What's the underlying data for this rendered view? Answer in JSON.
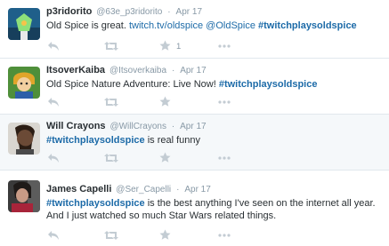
{
  "tweets": [
    {
      "fullname": "p3ridorito",
      "username": "@63e_p3ridorito",
      "dot": "·",
      "time": "Apr 17",
      "text_plain": "Old Spice is great.",
      "link1": "twitch.tv/oldspice",
      "mention": "@OldSpice",
      "hashtag": "#twitchplaysoldspice",
      "favorite_count": "1",
      "avatar_colors": {
        "bg": "#1f5f8a",
        "face": "#8ee07a",
        "accent": "#f6c34a"
      }
    },
    {
      "fullname": "ItsoverKaiba",
      "username": "@Itsoverkaiba",
      "dot": "·",
      "time": "Apr 17",
      "text_plain": "Old Spice Nature Adventure: Live Now!",
      "hashtag": "#twitchplaysoldspice",
      "avatar_colors": {
        "bg": "#4f8f3a",
        "face": "#f2cfa0",
        "accent": "#e0a52a"
      }
    },
    {
      "fullname": "Will Crayons",
      "username": "@WillCrayons",
      "dot": "·",
      "time": "Apr 17",
      "hashtag": "#twitchplaysoldspice",
      "text_plain": "is real funny",
      "avatar_colors": {
        "bg": "#d9d6d0",
        "face": "#6b4a36",
        "accent": "#2b1d14"
      }
    },
    {
      "fullname": "James Capelli",
      "username": "@Ser_Capelli",
      "dot": "·",
      "time": "Apr 17",
      "hashtag": "#twitchplaysoldspice",
      "text_plain": "is the best anything I've seen on the internet all year. And I just watched so much Star Wars related things.",
      "avatar_colors": {
        "bg": "#3a3a3a",
        "face": "#c89b86",
        "accent": "#a8243a"
      }
    }
  ],
  "icons": [
    "reply-icon",
    "retweet-icon",
    "favorite-icon",
    "more-icon"
  ],
  "colors": {
    "link": "#1d6ba8",
    "muted": "#8899a6",
    "action": "#c3ccd3",
    "highlight_bg": "#f5f8fa"
  }
}
